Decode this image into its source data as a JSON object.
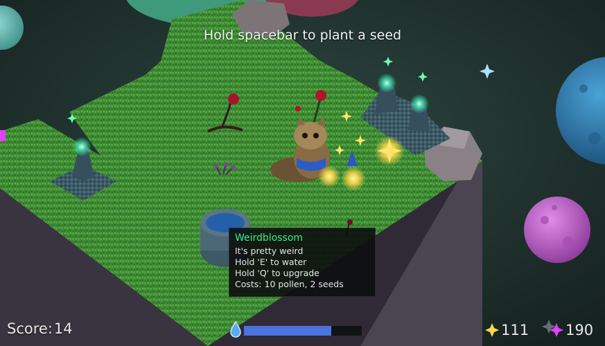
{
  "hud": {
    "hint": "Hold spacebar to plant a seed",
    "score_label": "Score:",
    "score_value": "14",
    "water_level": 0.74,
    "pollen_count": "111",
    "seed_count": "190",
    "water_icon": "water-drop-icon",
    "pollen_icon": "yellow-star-icon",
    "seed_icon": "magenta-star-icon"
  },
  "tooltip": {
    "title": "Weirdblossom",
    "lines": [
      "It's pretty weird",
      "Hold 'E' to water",
      "Hold 'Q' to upgrade",
      "Costs: 10 pollen, 2 seeds"
    ]
  },
  "colors": {
    "grass": "#3f8c35",
    "tooltip_title": "#3df08a",
    "water_fill": "#4b74e0",
    "pollen": "#ffd84a",
    "seeds": "#e040ff"
  }
}
